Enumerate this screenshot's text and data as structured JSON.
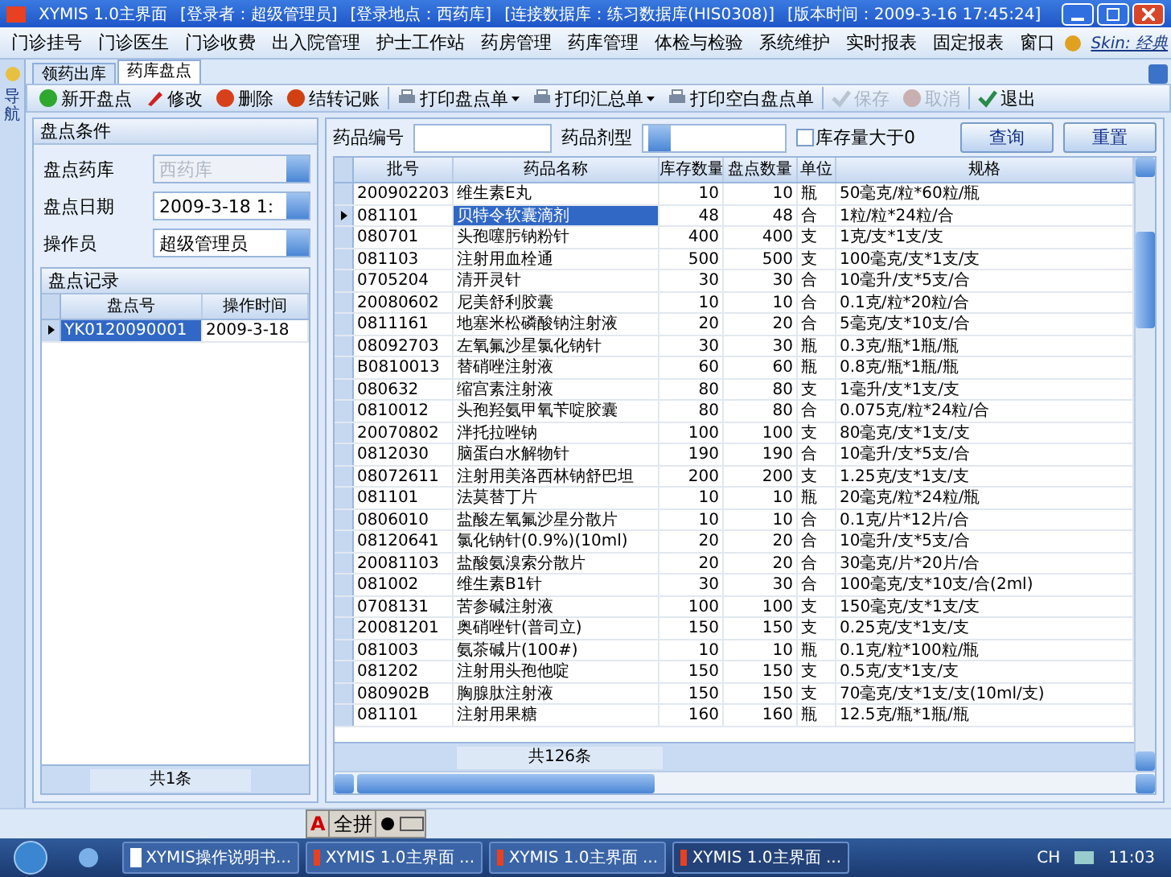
{
  "window": {
    "title": "XYMIS 1.0主界面",
    "info": [
      "[登录者：超级管理员]",
      "[登录地点：西药库]",
      "[连接数据库：练习数据库(HIS0308)]",
      "[版本时间：2009-3-16 17:45:24]"
    ]
  },
  "menu": [
    "门诊挂号",
    "门诊医生",
    "门诊收费",
    "出入院管理",
    "护士工作站",
    "药房管理",
    "药库管理",
    "体检与检验",
    "系统维护",
    "实时报表",
    "固定报表",
    "窗口"
  ],
  "skin": "Skin: 经典",
  "nav_strip": "导航",
  "tabs": [
    {
      "label": "领药出库",
      "selected": false
    },
    {
      "label": "药库盘点",
      "selected": true
    }
  ],
  "toolbar": [
    {
      "kind": "add",
      "label": "新开盘点",
      "disabled": false
    },
    {
      "kind": "edit",
      "label": "修改",
      "disabled": false
    },
    {
      "kind": "delete",
      "label": "删除",
      "disabled": false
    },
    {
      "kind": "post",
      "label": "结转记账",
      "disabled": false
    },
    {
      "kind": "print",
      "label": "打印盘点单",
      "dropdown": true,
      "disabled": false
    },
    {
      "kind": "print",
      "label": "打印汇总单",
      "dropdown": true,
      "disabled": false
    },
    {
      "kind": "print",
      "label": "打印空白盘点单",
      "disabled": false
    },
    {
      "kind": "save",
      "label": "保存",
      "disabled": true
    },
    {
      "kind": "cancel",
      "label": "取消",
      "disabled": true
    },
    {
      "kind": "exit",
      "label": "退出",
      "disabled": false
    }
  ],
  "conditions": {
    "title": "盘点条件",
    "fields": [
      {
        "label": "盘点药库",
        "value": "西药库",
        "disabled": true
      },
      {
        "label": "盘点日期",
        "value": "2009-3-18 1:",
        "disabled": false
      },
      {
        "label": "操作员",
        "value": "超级管理员",
        "disabled": false
      }
    ]
  },
  "records": {
    "title": "盘点记录",
    "columns": [
      "盘点号",
      "操作时间"
    ],
    "rows": [
      {
        "cells": [
          "YK0120090001",
          "2009-3-18"
        ],
        "selected": true
      }
    ],
    "footer": "共1条"
  },
  "filter": {
    "code_label": "药品编号",
    "type_label": "药品剂型",
    "checkbox": {
      "label": "库存量大于0",
      "checked": false
    },
    "buttons": [
      "查询",
      "重置"
    ]
  },
  "table": {
    "columns": [
      "批号",
      "药品名称",
      "库存数量",
      "盘点数量",
      "单位",
      "规格"
    ],
    "footer": "共126条",
    "rows": [
      {
        "cells": [
          "200902203",
          "维生素E丸",
          "10",
          "10",
          "瓶",
          "50毫克/粒*60粒/瓶"
        ],
        "selected": false
      },
      {
        "cells": [
          "081101",
          "贝特令软囊滴剂",
          "48",
          "48",
          "合",
          "1粒/粒*24粒/合"
        ],
        "selected": true
      },
      {
        "cells": [
          "080701",
          "头孢噻肟钠粉针",
          "400",
          "400",
          "支",
          "1克/支*1支/支"
        ],
        "selected": false
      },
      {
        "cells": [
          "081103",
          "注射用血栓通",
          "500",
          "500",
          "支",
          "100毫克/支*1支/支"
        ],
        "selected": false
      },
      {
        "cells": [
          "0705204",
          "清开灵针",
          "30",
          "30",
          "合",
          "10毫升/支*5支/合"
        ],
        "selected": false
      },
      {
        "cells": [
          "20080602",
          "尼美舒利胶囊",
          "10",
          "10",
          "合",
          "0.1克/粒*20粒/合"
        ],
        "selected": false
      },
      {
        "cells": [
          "0811161",
          "地塞米松磷酸钠注射液",
          "20",
          "20",
          "合",
          "5毫克/支*10支/合"
        ],
        "selected": false
      },
      {
        "cells": [
          "08092703",
          "左氧氟沙星氯化钠针",
          "30",
          "30",
          "瓶",
          "0.3克/瓶*1瓶/瓶"
        ],
        "selected": false
      },
      {
        "cells": [
          "B0810013",
          "替硝唑注射液",
          "60",
          "60",
          "瓶",
          "0.8克/瓶*1瓶/瓶"
        ],
        "selected": false
      },
      {
        "cells": [
          "080632",
          "缩宫素注射液",
          "80",
          "80",
          "支",
          "1毫升/支*1支/支"
        ],
        "selected": false
      },
      {
        "cells": [
          "0810012",
          "头孢羟氨甲氧苄啶胶囊",
          "80",
          "80",
          "合",
          "0.075克/粒*24粒/合"
        ],
        "selected": false
      },
      {
        "cells": [
          "20070802",
          "泮托拉唑钠",
          "100",
          "100",
          "支",
          "80毫克/支*1支/支"
        ],
        "selected": false
      },
      {
        "cells": [
          "0812030",
          "脑蛋白水解物针",
          "190",
          "190",
          "合",
          "10毫升/支*5支/合"
        ],
        "selected": false
      },
      {
        "cells": [
          "08072611",
          "注射用美洛西林钠舒巴坦",
          "200",
          "200",
          "支",
          "1.25克/支*1支/支"
        ],
        "selected": false
      },
      {
        "cells": [
          "081101",
          "法莫替丁片",
          "10",
          "10",
          "瓶",
          "20毫克/粒*24粒/瓶"
        ],
        "selected": false
      },
      {
        "cells": [
          "0806010",
          "盐酸左氧氟沙星分散片",
          "10",
          "10",
          "合",
          "0.1克/片*12片/合"
        ],
        "selected": false
      },
      {
        "cells": [
          "08120641",
          "氯化钠针(0.9%)(10ml)",
          "20",
          "20",
          "合",
          "10毫升/支*5支/合"
        ],
        "selected": false
      },
      {
        "cells": [
          "20081103",
          "盐酸氨溴索分散片",
          "20",
          "20",
          "合",
          "30毫克/片*20片/合"
        ],
        "selected": false
      },
      {
        "cells": [
          "081002",
          "维生素B1针",
          "30",
          "30",
          "合",
          "100毫克/支*10支/合(2ml)"
        ],
        "selected": false
      },
      {
        "cells": [
          "0708131",
          "苦参碱注射液",
          "100",
          "100",
          "支",
          "150毫克/支*1支/支"
        ],
        "selected": false
      },
      {
        "cells": [
          "20081201",
          "奥硝唑针(普司立)",
          "150",
          "150",
          "支",
          "0.25克/支*1支/支"
        ],
        "selected": false
      },
      {
        "cells": [
          "081003",
          "氨茶碱片(100#)",
          "10",
          "10",
          "瓶",
          "0.1克/粒*100粒/瓶"
        ],
        "selected": false
      },
      {
        "cells": [
          "081202",
          "注射用头孢他啶",
          "150",
          "150",
          "支",
          "0.5克/支*1支/支"
        ],
        "selected": false
      },
      {
        "cells": [
          "080902B",
          "胸腺肽注射液",
          "150",
          "150",
          "支",
          "70毫克/支*1支/支(10ml/支)"
        ],
        "selected": false
      },
      {
        "cells": [
          "081101",
          "注射用果糖",
          "160",
          "160",
          "瓶",
          "12.5克/瓶*1瓶/瓶"
        ],
        "selected": false
      }
    ]
  },
  "ime": [
    "A",
    "全拼"
  ],
  "taskbar": {
    "items": [
      {
        "label": "XYMIS操作说明书...",
        "kind": "doc",
        "active": false
      },
      {
        "label": "XYMIS 1.0主界面 ...",
        "kind": "app",
        "active": false
      },
      {
        "label": "XYMIS 1.0主界面 ...",
        "kind": "app",
        "active": false
      },
      {
        "label": "XYMIS 1.0主界面 ...",
        "kind": "app",
        "active": true
      }
    ],
    "lang": "CH",
    "time": "11:03"
  }
}
